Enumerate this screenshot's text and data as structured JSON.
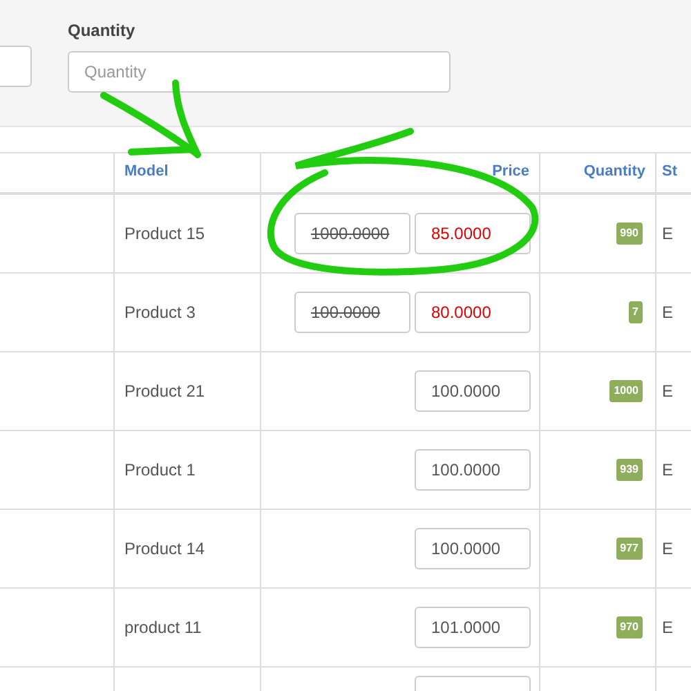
{
  "filter": {
    "label": "Quantity",
    "placeholder": "Quantity"
  },
  "table": {
    "columns": [
      "Model",
      "Price",
      "Quantity",
      "St"
    ],
    "rows": [
      {
        "model": "Product 15",
        "kind": "special",
        "old_price": "1000.0000",
        "price": "85.0000",
        "quantity": "990",
        "status": "E"
      },
      {
        "model": "Product 3",
        "kind": "special",
        "old_price": "100.0000",
        "price": "80.0000",
        "quantity": "7",
        "status": "E"
      },
      {
        "model": "Product 21",
        "kind": "regular",
        "price": "100.0000",
        "quantity": "1000",
        "status": "E"
      },
      {
        "model": "Product 1",
        "kind": "regular",
        "price": "100.0000",
        "quantity": "939",
        "status": "E"
      },
      {
        "model": "Product 14",
        "kind": "regular",
        "price": "100.0000",
        "quantity": "977",
        "status": "E"
      },
      {
        "model": "product 11",
        "kind": "regular",
        "price": "101.0000",
        "quantity": "970",
        "status": "E"
      }
    ]
  }
}
